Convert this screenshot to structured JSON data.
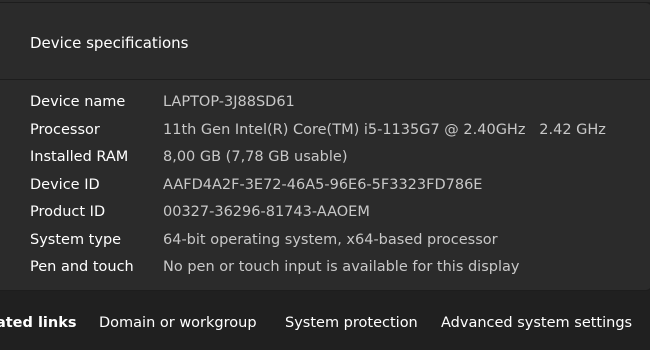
{
  "card": {
    "title": "Device specifications",
    "specs": [
      {
        "label": "Device name",
        "value": "LAPTOP-3J88SD61"
      },
      {
        "label": "Processor",
        "value": "11th Gen Intel(R) Core(TM) i5-1135G7 @ 2.40GHz   2.42 GHz"
      },
      {
        "label": "Installed RAM",
        "value": "8,00 GB (7,78 GB usable)"
      },
      {
        "label": "Device ID",
        "value": "AAFD4A2F-3E72-46A5-96E6-5F3323FD786E"
      },
      {
        "label": "Product ID",
        "value": "00327-36296-81743-AAOEM"
      },
      {
        "label": "System type",
        "value": "64-bit operating system, x64-based processor"
      },
      {
        "label": "Pen and touch",
        "value": "No pen or touch input is available for this display"
      }
    ]
  },
  "related": {
    "label": "lated links",
    "links": [
      "Domain or workgroup",
      "System protection",
      "Advanced system settings"
    ]
  },
  "icons": {
    "expand": "chevron-up-icon"
  }
}
